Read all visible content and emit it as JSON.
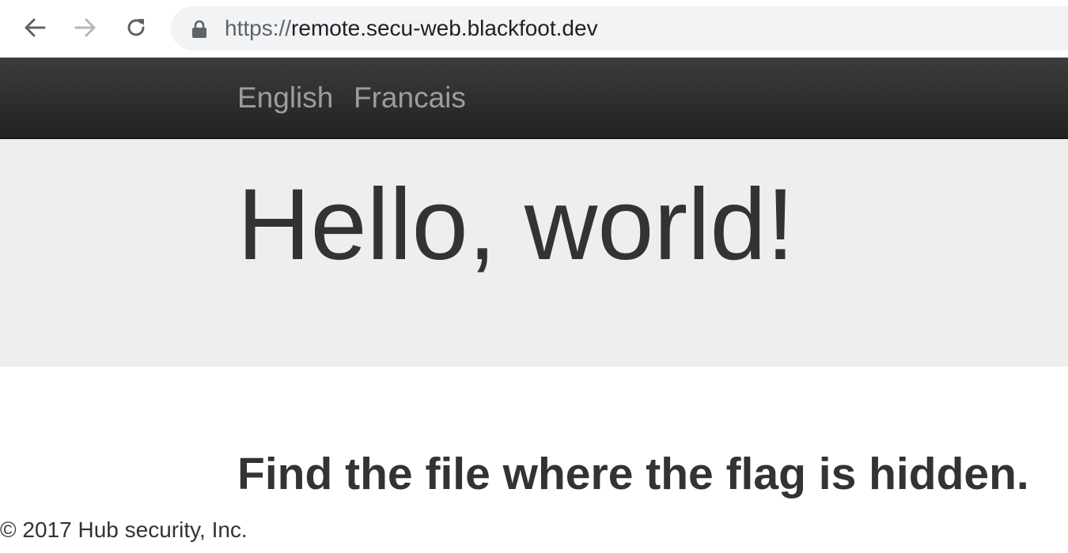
{
  "browser": {
    "url_scheme": "https://",
    "url_host": "remote.secu-web.blackfoot.dev",
    "icons": {
      "back": "arrow-left-icon",
      "forward": "arrow-right-icon",
      "reload": "reload-icon",
      "secure": "lock-icon"
    }
  },
  "navbar": {
    "links": [
      {
        "label": "English"
      },
      {
        "label": "Francais"
      }
    ]
  },
  "jumbotron": {
    "title": "Hello, world!"
  },
  "main": {
    "heading": "Find the file where the flag is hidden."
  },
  "footer": {
    "text": "© 2017 Hub security, Inc."
  },
  "colors": {
    "navbar_top": "#3c3c3c",
    "navbar_bottom": "#222222",
    "nav_link": "#9d9d9d",
    "jumbotron_bg": "#eeeeee",
    "text": "#333333",
    "address_bar_bg": "#f1f3f4"
  }
}
